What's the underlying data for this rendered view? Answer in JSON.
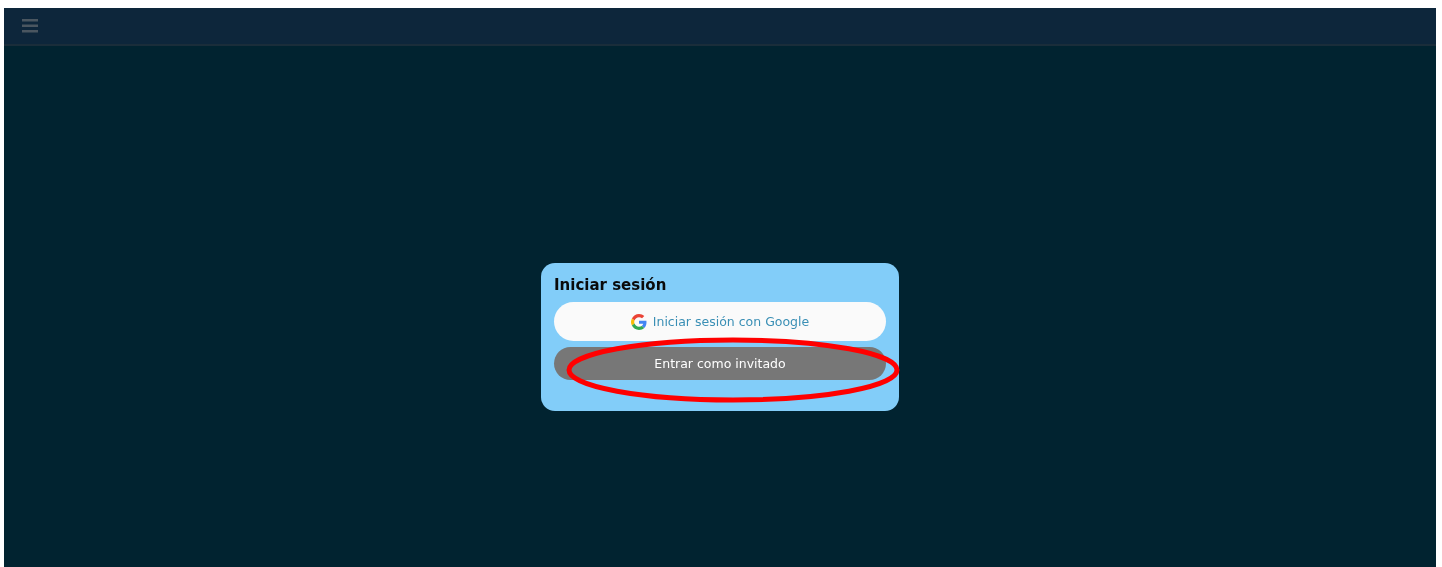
{
  "login": {
    "title": "Iniciar sesión",
    "buttons": [
      {
        "kind": "google",
        "label": "Iniciar sesión con Google"
      },
      {
        "kind": "guest",
        "label": "Entrar como invitado"
      }
    ]
  },
  "annotation": {
    "kind": "ellipse"
  }
}
